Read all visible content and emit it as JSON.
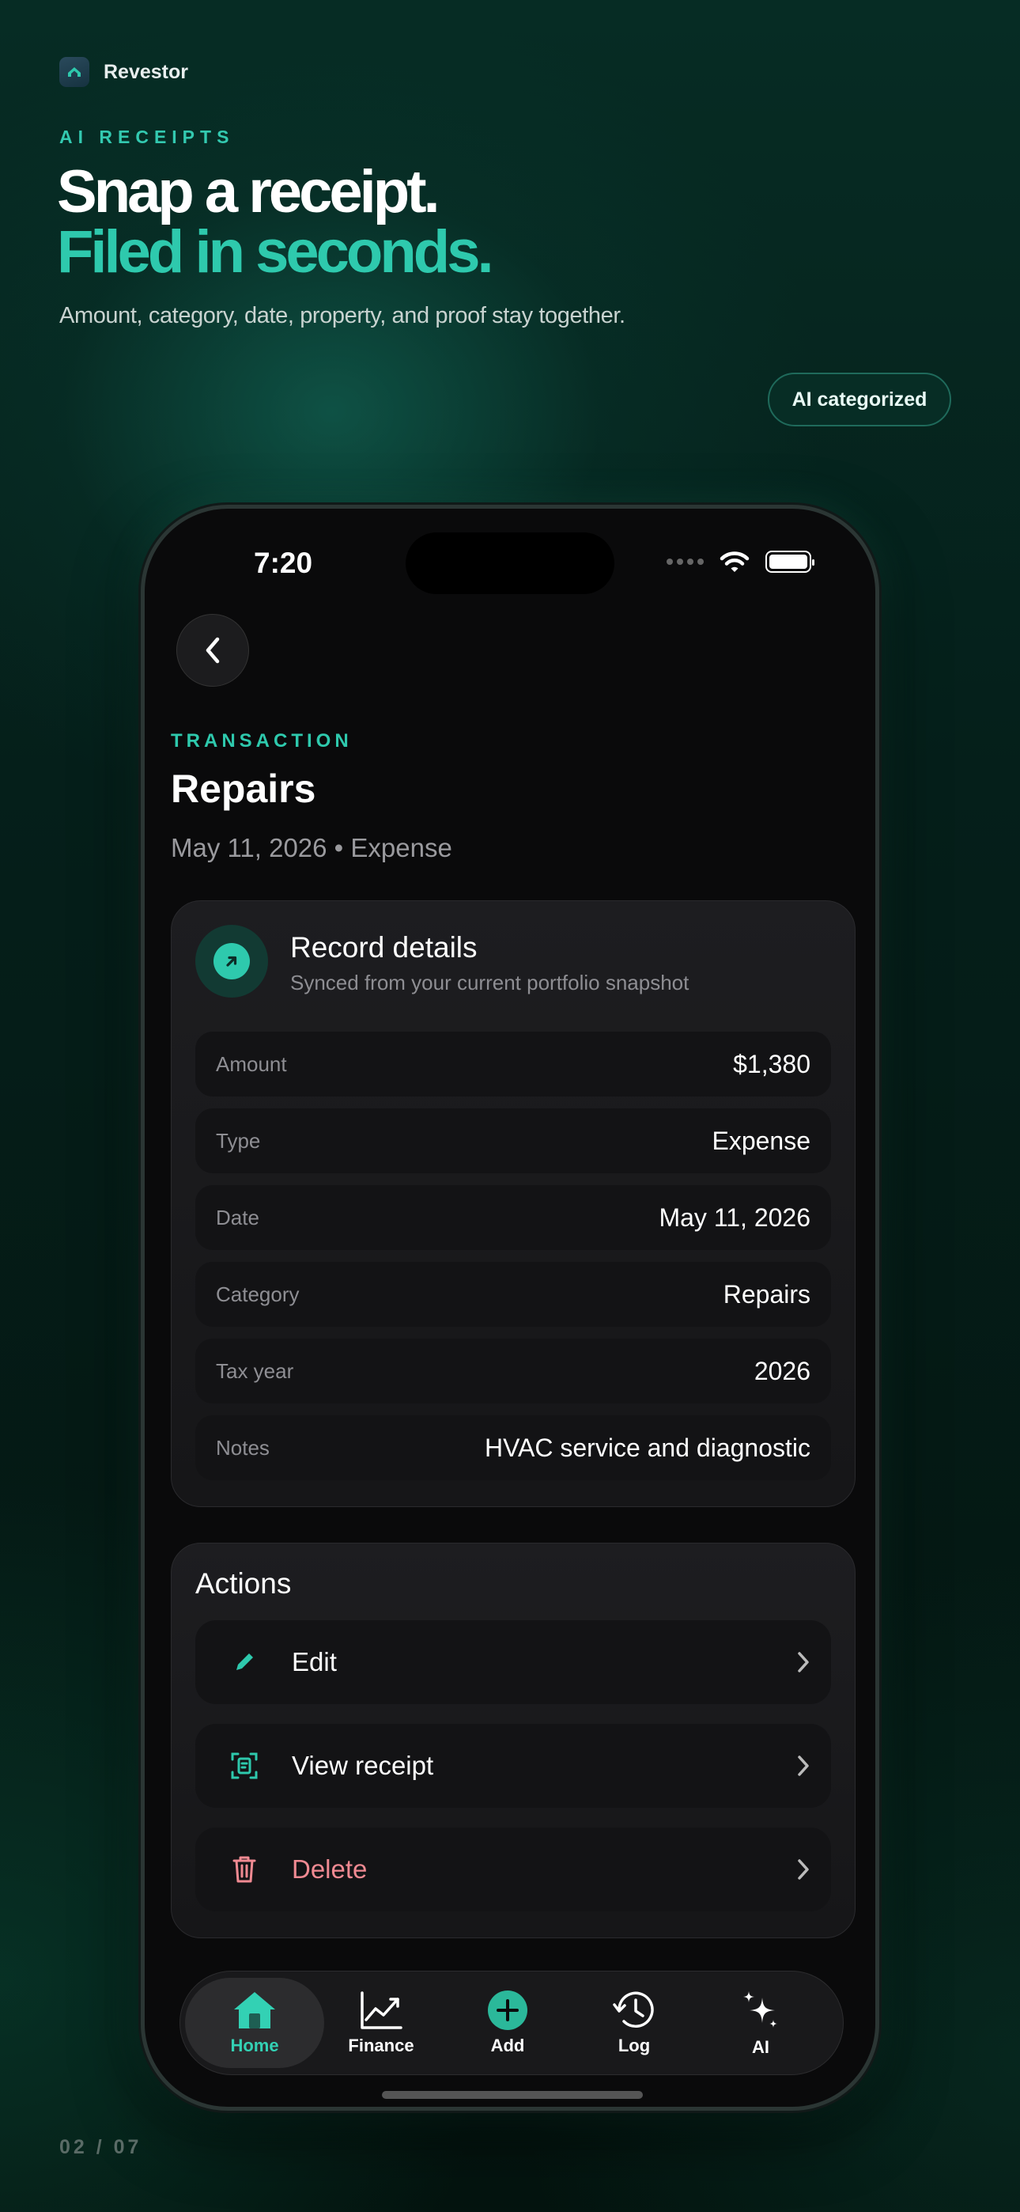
{
  "brand": {
    "name": "Revestor"
  },
  "hero": {
    "eyebrow": "AI RECEIPTS",
    "headline_1": "Snap a receipt.",
    "headline_2": "Filed in seconds.",
    "subline": "Amount, category, date, property, and proof stay together.",
    "badge": "AI categorized"
  },
  "status_bar": {
    "time": "7:20"
  },
  "transaction": {
    "eyebrow": "TRANSACTION",
    "title": "Repairs",
    "meta": "May 11, 2026 • Expense"
  },
  "details": {
    "title": "Record details",
    "subtitle": "Synced from your current portfolio snapshot",
    "rows": [
      {
        "label": "Amount",
        "value": "$1,380"
      },
      {
        "label": "Type",
        "value": "Expense"
      },
      {
        "label": "Date",
        "value": "May 11, 2026"
      },
      {
        "label": "Category",
        "value": "Repairs"
      },
      {
        "label": "Tax year",
        "value": "2026"
      },
      {
        "label": "Notes",
        "value": "HVAC service and diagnostic"
      }
    ]
  },
  "actions": {
    "title": "Actions",
    "items": [
      {
        "label": "Edit",
        "icon": "pencil-icon"
      },
      {
        "label": "View receipt",
        "icon": "receipt-scan-icon"
      },
      {
        "label": "Delete",
        "icon": "trash-icon"
      }
    ]
  },
  "tabbar": {
    "active": "Home",
    "items": [
      {
        "label": "Home",
        "icon": "home-icon"
      },
      {
        "label": "Finance",
        "icon": "chart-icon"
      },
      {
        "label": "Add",
        "icon": "plus-circle-icon"
      },
      {
        "label": "Log",
        "icon": "history-icon"
      },
      {
        "label": "AI",
        "icon": "sparkles-icon"
      }
    ]
  },
  "colors": {
    "accent": "#2ec9ad",
    "danger": "#f08a92",
    "background": "#0a0a0b"
  },
  "page": {
    "number": "02 / 07"
  }
}
